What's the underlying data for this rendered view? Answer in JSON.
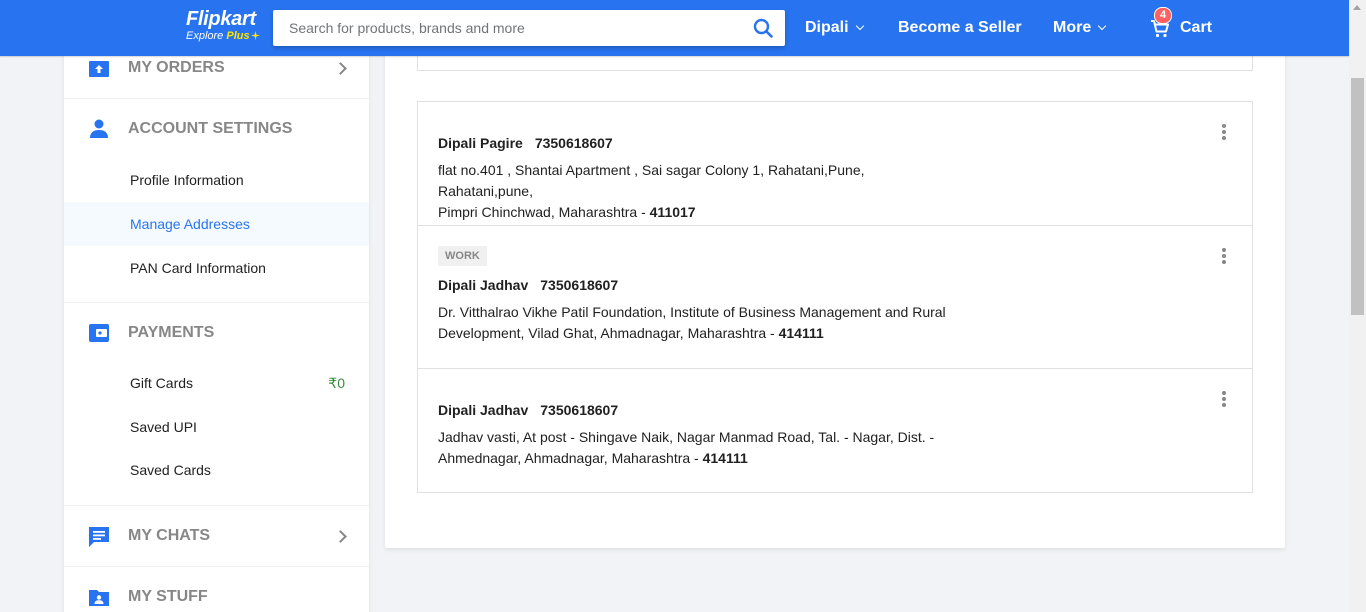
{
  "header": {
    "logo_text": "Flipkart",
    "logo_sub": "Explore",
    "logo_plus": "Plus",
    "search_placeholder": "Search for products, brands and more",
    "user_name": "Dipali",
    "seller_label": "Become a Seller",
    "more_label": "More",
    "cart_label": "Cart",
    "cart_count": "4",
    "brand_color": "#2874f0",
    "accent_color": "#ffe500"
  },
  "sidebar": {
    "my_orders": "MY ORDERS",
    "account_settings": "ACCOUNT SETTINGS",
    "account_items": [
      "Profile Information",
      "Manage Addresses",
      "PAN Card Information"
    ],
    "payments": "PAYMENTS",
    "payment_items": [
      "Gift Cards",
      "Saved UPI",
      "Saved Cards"
    ],
    "gift_card_amount": "₹0",
    "my_chats": "MY CHATS",
    "my_stuff": "MY STUFF"
  },
  "addresses": [
    {
      "tag": "",
      "name": "Dipali Pagire",
      "phone": "7350618607",
      "line1": "flat no.401 , Shantai Apartment , Sai sagar Colony 1, Rahatani,Pune, Rahatani,pune,",
      "line2": "Pimpri Chinchwad, Maharashtra - ",
      "pin": "411017"
    },
    {
      "tag": "WORK",
      "name": "Dipali Jadhav",
      "phone": "7350618607",
      "line1": "Dr. Vitthalrao Vikhe Patil Foundation, Institute of Business Management and Rural",
      "line2": "Development, Vilad Ghat, Ahmadnagar, Maharashtra - ",
      "pin": "414111"
    },
    {
      "tag": "",
      "name": "Dipali Jadhav",
      "phone": "7350618607",
      "line1": "Jadhav vasti, At post - Shingave Naik, Nagar Manmad Road, Tal. - Nagar, Dist. -",
      "line2": "Ahmednagar, Ahmadnagar, Maharashtra - ",
      "pin": "414111"
    }
  ]
}
